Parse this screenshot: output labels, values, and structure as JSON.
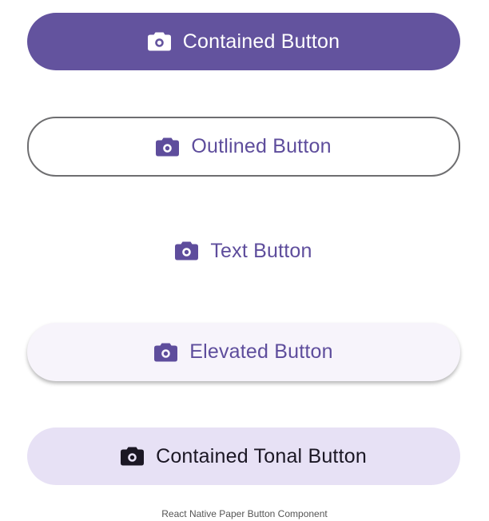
{
  "buttons": {
    "contained": {
      "label": "Contained Button",
      "icon": "camera-icon"
    },
    "outlined": {
      "label": "Outlined Button",
      "icon": "camera-icon"
    },
    "text": {
      "label": "Text Button",
      "icon": "camera-icon"
    },
    "elevated": {
      "label": "Elevated Button",
      "icon": "camera-icon"
    },
    "tonal": {
      "label": "Contained Tonal Button",
      "icon": "camera-icon"
    }
  },
  "caption": "React Native Paper Button Component",
  "colors": {
    "primary": "#63539e",
    "primary_text": "#5e4d9c",
    "outline": "#6e6e70",
    "elevated_bg": "#f7f4fb",
    "tonal_bg": "#e7e1f5",
    "tonal_text": "#1b1724"
  }
}
